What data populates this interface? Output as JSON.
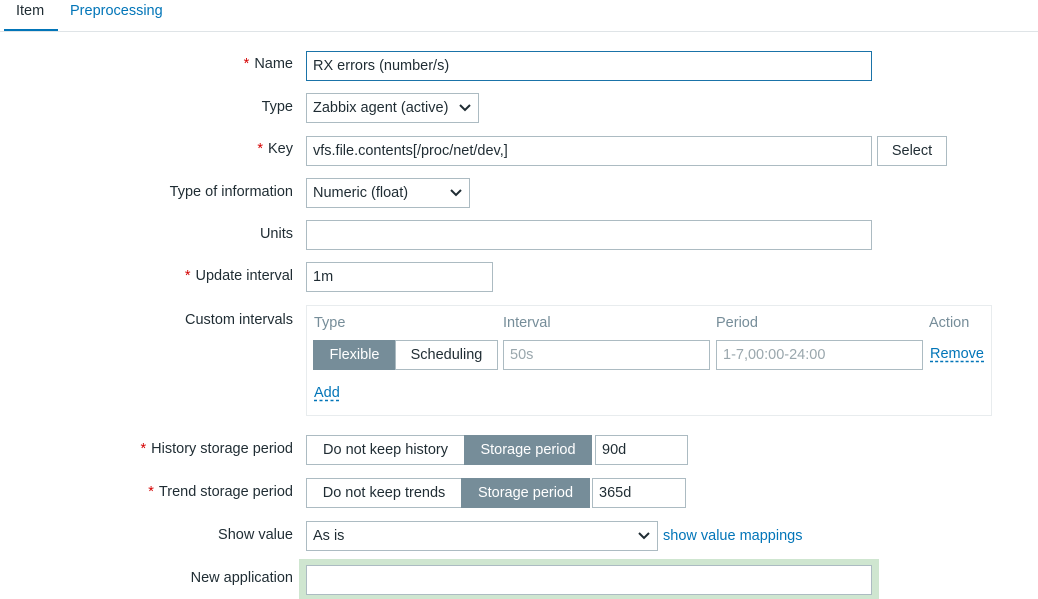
{
  "tabs": [
    {
      "label": "Item"
    },
    {
      "label": "Preprocessing"
    }
  ],
  "form": {
    "name": {
      "label": "Name",
      "value": "RX errors  (number/s)"
    },
    "type": {
      "label": "Type",
      "value": "Zabbix agent (active)"
    },
    "key": {
      "label": "Key",
      "value": "vfs.file.contents[/proc/net/dev,]",
      "select_button": "Select"
    },
    "type_of_information": {
      "label": "Type of information",
      "value": "Numeric (float)"
    },
    "units": {
      "label": "Units",
      "value": ""
    },
    "update_interval": {
      "label": "Update interval",
      "value": "1m"
    },
    "custom_intervals": {
      "label": "Custom intervals",
      "headers": {
        "type": "Type",
        "interval": "Interval",
        "period": "Period",
        "action": "Action"
      },
      "row": {
        "flexible": "Flexible",
        "scheduling": "Scheduling",
        "interval_placeholder": "50s",
        "period_placeholder": "1-7,00:00-24:00",
        "remove": "Remove"
      },
      "add": "Add"
    },
    "history": {
      "label": "History storage period",
      "option_off": "Do not keep history",
      "option_on": "Storage period",
      "value": "90d"
    },
    "trend": {
      "label": "Trend storage period",
      "option_off": "Do not keep trends",
      "option_on": "Storage period",
      "value": "365d"
    },
    "show_value": {
      "label": "Show value",
      "value": "As is",
      "link": "show value mappings"
    },
    "new_application": {
      "label": "New application",
      "value": ""
    }
  },
  "colors": {
    "accent": "#0275b8",
    "required": "#d40000",
    "segment_active": "#768d99"
  }
}
